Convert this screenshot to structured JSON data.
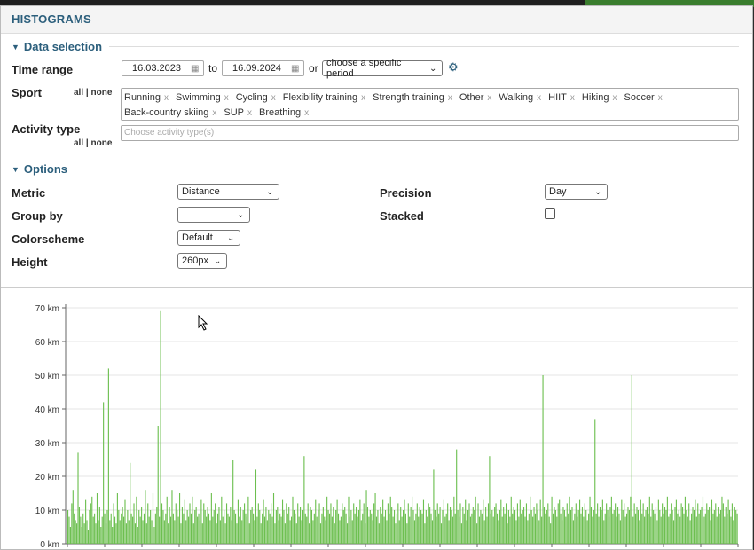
{
  "dialog": {
    "title": "HISTOGRAMS"
  },
  "data_selection": {
    "heading": "Data selection",
    "time_range": {
      "label": "Time range",
      "from": "16.03.2023",
      "to_word": "to",
      "to": "16.09.2024",
      "or_word": "or",
      "period_select": "choose a specific period"
    },
    "sport": {
      "label": "Sport",
      "all": "all",
      "sep": "|",
      "none": "none",
      "tags": [
        "Running",
        "Swimming",
        "Cycling",
        "Flexibility training",
        "Strength training",
        "Other",
        "Walking",
        "HIIT",
        "Hiking",
        "Soccer",
        "Back-country skiing",
        "SUP",
        "Breathing"
      ],
      "remove_glyph": "x"
    },
    "activity_type": {
      "label": "Activity type",
      "placeholder": "Choose activity type(s)",
      "all": "all",
      "sep": "|",
      "none": "none"
    }
  },
  "options": {
    "heading": "Options",
    "metric": {
      "label": "Metric",
      "value": "Distance"
    },
    "group_by": {
      "label": "Group by",
      "value": ""
    },
    "colorscheme": {
      "label": "Colorscheme",
      "value": "Default"
    },
    "height": {
      "label": "Height",
      "value": "260px"
    },
    "precision": {
      "label": "Precision",
      "value": "Day"
    },
    "stacked": {
      "label": "Stacked",
      "checked": false
    }
  },
  "colors": {
    "accent": "#2c5f7c",
    "bar": "#6cbf4f"
  },
  "chart_data": {
    "type": "bar",
    "ylim": [
      0,
      70
    ],
    "yticks": [
      "0 km",
      "10 km",
      "20 km",
      "30 km",
      "40 km",
      "50 km",
      "60 km",
      "70 km"
    ],
    "grid": true,
    "values": [
      10,
      8,
      5,
      12,
      16,
      9,
      7,
      6,
      27,
      11,
      8,
      5,
      9,
      6,
      13,
      7,
      4,
      10,
      12,
      14,
      8,
      9,
      6,
      15,
      7,
      11,
      5,
      8,
      42,
      9,
      6,
      10,
      52,
      7,
      9,
      5,
      12,
      8,
      6,
      15,
      10,
      7,
      9,
      11,
      8,
      13,
      6,
      10,
      7,
      24,
      9,
      8,
      12,
      6,
      14,
      5,
      10,
      8,
      11,
      7,
      9,
      16,
      6,
      12,
      8,
      10,
      7,
      15,
      5,
      9,
      11,
      35,
      8,
      69,
      12,
      10,
      7,
      9,
      14,
      6,
      11,
      8,
      16,
      9,
      7,
      12,
      10,
      8,
      15,
      6,
      11,
      9,
      13,
      7,
      10,
      8,
      12,
      9,
      14,
      6,
      10,
      11,
      8,
      9,
      7,
      13,
      6,
      12,
      10,
      8,
      11,
      9,
      7,
      15,
      8,
      10,
      12,
      6,
      9,
      11,
      7,
      14,
      8,
      10,
      6,
      12,
      9,
      8,
      11,
      7,
      25,
      10,
      9,
      6,
      13,
      8,
      11,
      7,
      10,
      12,
      9,
      8,
      14,
      6,
      10,
      11,
      9,
      7,
      22,
      8,
      12,
      10,
      6,
      9,
      13,
      8,
      11,
      7,
      10,
      9,
      12,
      8,
      15,
      6,
      10,
      11,
      7,
      9,
      8,
      13,
      10,
      6,
      12,
      9,
      11,
      7,
      8,
      14,
      10,
      9,
      6,
      12,
      8,
      11,
      7,
      10,
      26,
      9,
      8,
      12,
      6,
      11,
      10,
      7,
      9,
      13,
      8,
      10,
      12,
      6,
      9,
      11,
      8,
      7,
      14,
      10,
      9,
      12,
      8,
      11,
      6,
      10,
      13,
      9,
      7,
      8,
      12,
      10,
      11,
      9,
      6,
      14,
      8,
      10,
      7,
      12,
      9,
      11,
      8,
      10,
      13,
      7,
      9,
      12,
      6,
      16,
      11,
      8,
      10,
      9,
      7,
      12,
      15,
      8,
      10,
      6,
      11,
      9,
      13,
      8,
      10,
      7,
      12,
      9,
      14,
      11,
      8,
      10,
      6,
      9,
      12,
      7,
      11,
      8,
      10,
      13,
      9,
      6,
      12,
      8,
      11,
      14,
      10,
      7,
      9,
      12,
      8,
      11,
      10,
      9,
      13,
      6,
      10,
      8,
      12,
      11,
      9,
      7,
      22,
      10,
      8,
      12,
      9,
      11,
      6,
      10,
      13,
      8,
      9,
      12,
      7,
      11,
      10,
      8,
      14,
      9,
      28,
      10,
      8,
      12,
      6,
      11,
      9,
      13,
      7,
      10,
      12,
      8,
      9,
      11,
      10,
      14,
      6,
      12,
      8,
      10,
      9,
      13,
      7,
      11,
      8,
      12,
      26,
      9,
      10,
      8,
      11,
      12,
      9,
      7,
      10,
      13,
      8,
      11,
      9,
      12,
      6,
      10,
      8,
      14,
      9,
      11,
      10,
      7,
      12,
      8,
      13,
      9,
      10,
      11,
      8,
      12,
      7,
      9,
      14,
      10,
      8,
      11,
      9,
      12,
      10,
      7,
      13,
      8,
      50,
      11,
      9,
      10,
      12,
      8,
      6,
      14,
      9,
      11,
      10,
      8,
      12,
      13,
      9,
      7,
      11,
      10,
      8,
      12,
      9,
      14,
      10,
      11,
      7,
      9,
      12,
      8,
      10,
      13,
      9,
      11,
      8,
      12,
      10,
      7,
      9,
      14,
      11,
      8,
      10,
      37,
      9,
      12,
      8,
      11,
      10,
      13,
      7,
      9,
      12,
      10,
      8,
      11,
      14,
      9,
      10,
      12,
      8,
      11,
      9,
      7,
      13,
      10,
      12,
      8,
      9,
      11,
      10,
      14,
      50,
      8,
      12,
      9,
      11,
      10,
      7,
      13,
      9,
      12,
      8,
      10,
      11,
      9,
      14,
      8,
      12,
      10,
      9,
      11,
      7,
      13,
      10,
      8,
      12,
      9,
      11,
      10,
      14,
      8,
      9,
      12,
      10,
      7,
      11,
      13,
      9,
      10,
      8,
      12,
      11,
      9,
      14,
      10,
      8,
      12,
      7,
      9,
      11,
      10,
      13,
      8,
      12,
      9,
      10,
      11,
      14,
      8,
      9,
      12,
      10,
      11,
      7,
      13,
      9,
      10,
      12,
      8,
      11,
      9,
      10,
      14,
      12,
      8,
      11,
      9,
      13,
      10,
      8,
      12,
      7,
      11,
      10,
      9
    ]
  }
}
